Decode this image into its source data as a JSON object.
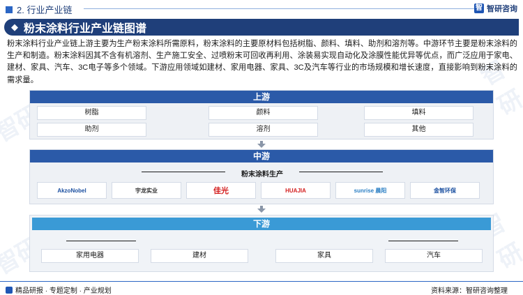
{
  "header": {
    "section_label": "2. 行业产业链",
    "brand": "智研咨询",
    "brand_mark": "智"
  },
  "title": "粉末涂料行业产业链图谱",
  "description": "粉末涂料行业产业链上游主要为生产粉末涂料所需原料，粉末涂料的主要原材料包括树脂、颜料、填料、助剂和溶剂等。中游环节主要是粉末涂料的生产和制造。粉末涂料因其不含有机溶剂、生产施工安全、过喷粉末可回收再利用、涂装易实现自动化及涂膜性能优异等优点，而广泛应用于家电、建材、家具、汽车、3C电子等多个领域。下游应用领域如建材、家用电器、家具、3C及汽车等行业的市场规模和增长速度，直接影响到粉末涂料的需求量。",
  "upstream": {
    "label": "上游",
    "items": [
      "树脂",
      "颜料",
      "填料",
      "助剂",
      "溶剂",
      "其他"
    ]
  },
  "midstream": {
    "label": "中游",
    "subtitle": "粉末涂料生产",
    "logos": [
      {
        "name": "AkzoNobel",
        "color": "#1a4fa0"
      },
      {
        "name": "宇龙实业",
        "color": "#333333"
      },
      {
        "name": "佳光",
        "color": "#d42020"
      },
      {
        "name": "HUAJIA",
        "color": "#d42020"
      },
      {
        "name": "sunrise 晨阳",
        "color": "#2b7fc4"
      },
      {
        "name": "金智环保",
        "color": "#1a4fa0"
      }
    ]
  },
  "downstream": {
    "label": "下游",
    "items": [
      "家用电器",
      "建材",
      "家具",
      "汽车"
    ]
  },
  "footer": {
    "left": "精品研报 · 专题定制 · 产业规划",
    "right": "资料来源：智研咨询整理"
  },
  "watermark": "智研"
}
